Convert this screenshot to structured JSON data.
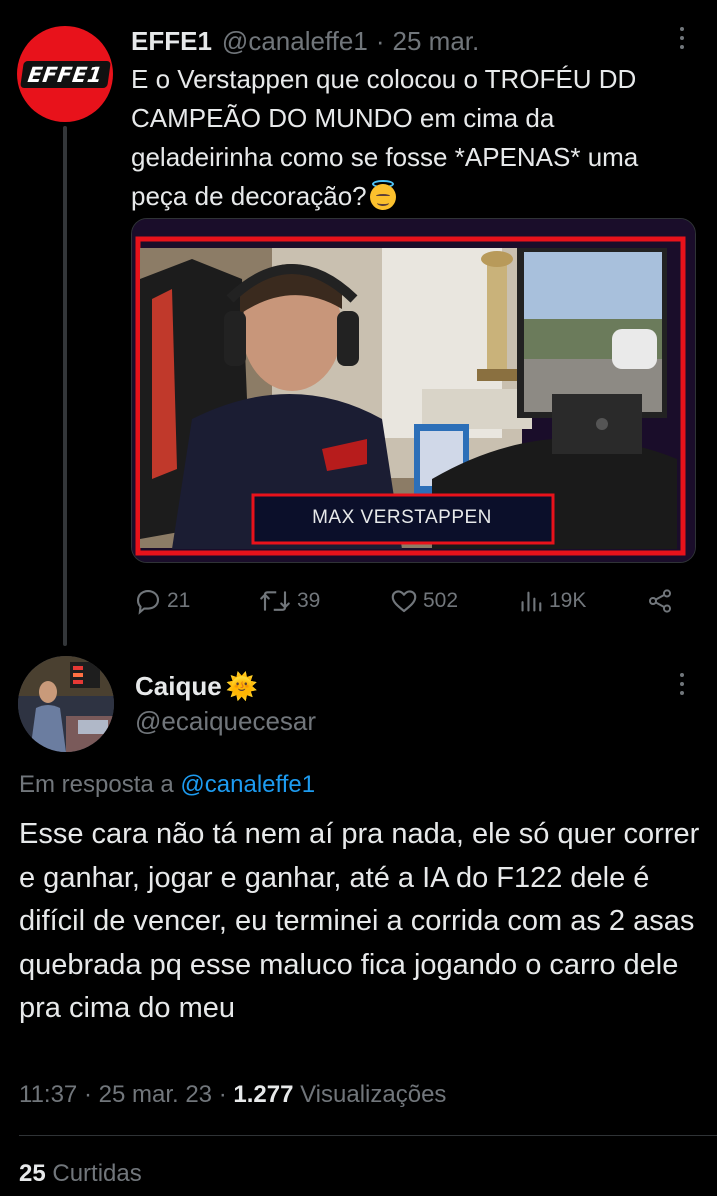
{
  "parent_tweet": {
    "avatar_logo_text": "EFFE1",
    "author_name": "EFFE1",
    "handle": "@canaleffe1",
    "separator": "·",
    "date": "25 mar.",
    "text": "E o Verstappen que colocou o TROFÉU DD CAMPEÃO DO MUNDO em cima da geladeirinha como se fosse *APENAS* uma peça de decoração?",
    "emoji": "smiling-face-with-halo",
    "media": {
      "caption": "MAX VERSTAPPEN",
      "frame_color": "#e8121b"
    },
    "actions": {
      "replies": "21",
      "retweets": "39",
      "likes": "502",
      "views": "19K"
    }
  },
  "reply_tweet": {
    "author_name": "Caique",
    "name_emoji": "🌞",
    "handle": "@ecaiquecesar",
    "reply_to_label": "Em resposta a",
    "reply_to_handle": "@canaleffe1",
    "text": "Esse cara não tá nem aí pra nada, ele só quer correr e ganhar, jogar e ganhar, até a IA do F122 dele é difícil de vencer, eu terminei a corrida com as 2 asas quebrada pq esse maluco fica jogando o carro dele pra cima do meu",
    "time": "11:37",
    "meta_separator": "·",
    "date": "25 mar. 23",
    "views_count": "1.277",
    "views_label": "Visualizações",
    "likes_count": "25",
    "likes_label": "Curtidas"
  },
  "colors": {
    "background": "#000000",
    "text_primary": "#e7e9ea",
    "text_secondary": "#71767b",
    "link": "#1d9bf0",
    "brand_red": "#e8121b",
    "divider": "#2f3336"
  },
  "icons": [
    "more-icon",
    "reply-icon",
    "retweet-icon",
    "like-icon",
    "views-icon",
    "share-icon"
  ]
}
